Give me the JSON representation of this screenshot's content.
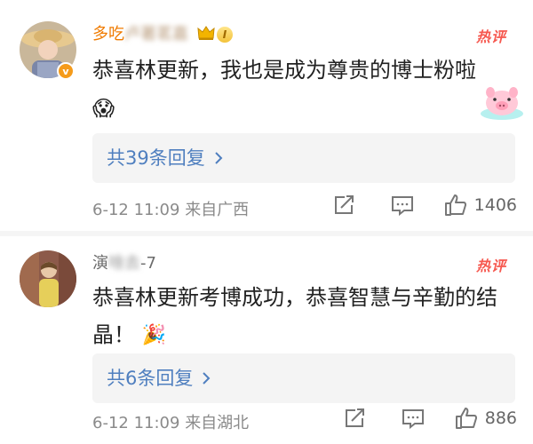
{
  "comments": [
    {
      "username_visible": "多吃",
      "username_obscured": "卢著茗嘉",
      "level_badge": "I",
      "hot_label": "热评",
      "text": "恭喜林更新，我也是成为尊贵的博士粉啦",
      "emoji": "😱",
      "replies_label": "共39条回复",
      "time": "6-12 11:09",
      "location": "来自广西",
      "likes": "1406"
    },
    {
      "username_visible": "演",
      "username_obscured": "啥去",
      "username_suffix": "-7",
      "hot_label": "热评",
      "text": "恭喜林更新考博成功，恭喜智慧与辛勤的结晶！",
      "emoji": "🎉",
      "replies_label": "共6条回复",
      "time": "6-12 11:09",
      "location": "来自湖北",
      "likes": "886"
    }
  ],
  "icons": {
    "reply_chevron": "chevron-right-icon",
    "share": "share-icon",
    "comment": "comment-icon",
    "like": "like-icon"
  },
  "colors": {
    "hot": "#f6584f",
    "link": "#4f7fbf",
    "username_vip": "#f07b00",
    "verified": "#f59b1a"
  }
}
